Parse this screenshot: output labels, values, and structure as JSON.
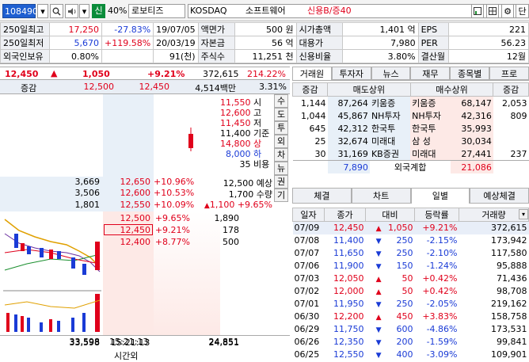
{
  "toolbar": {
    "code": "108490",
    "credit_badge": "신",
    "margin_rate": "40%",
    "stock_name": "로보티즈",
    "market": "KOSDAQ",
    "sector": "소프트웨어",
    "credit_info": "신용B/증40",
    "last_button": "단"
  },
  "info": {
    "rows": [
      [
        "250일최고",
        "17,250",
        "-27.83%",
        "19/07/05",
        "액면가",
        "500 원",
        "시가총액",
        "1,401 억",
        "EPS",
        "221"
      ],
      [
        "250일최저",
        "5,670",
        "+119.58%",
        "20/03/19",
        "자본금",
        "56 억",
        "대용가",
        "7,980",
        "PER",
        "56.23"
      ],
      [
        "외국인보유",
        "0.80%",
        "",
        "91(천)",
        "주식수",
        "11,251 천",
        "신용비율",
        "3.80%",
        "결산월",
        "12월"
      ]
    ]
  },
  "price_bar": {
    "price": "12,450",
    "change": "1,050",
    "rate": "+9.21%",
    "volume": "372,615",
    "vol_rate": "214.22%"
  },
  "header2": {
    "label": "증감",
    "ask": "12,500",
    "bid": "12,450",
    "amount": "4,514백만",
    "pct": "3.31%"
  },
  "side_info": [
    {
      "val": "11,550",
      "lbl": "시"
    },
    {
      "val": "12,600",
      "lbl": "고"
    },
    {
      "val": "11,450",
      "lbl": "저"
    },
    {
      "val": "11,400",
      "lbl": "기준"
    },
    {
      "val": "14,800",
      "lbl": "상"
    },
    {
      "val": "8,000",
      "lbl": "하"
    },
    {
      "val": "35",
      "lbl": "비용"
    }
  ],
  "side_tabs": [
    "수",
    "도",
    "투",
    "외",
    "차",
    "뉴",
    "권",
    "기"
  ],
  "asks": [
    {
      "qty": "3,669",
      "price": "12,650",
      "rate": "+10.96%"
    },
    {
      "qty": "3,506",
      "price": "12,600",
      "rate": "+10.53%"
    },
    {
      "qty": "1,801",
      "price": "12,550",
      "rate": "+10.09%"
    }
  ],
  "expected": {
    "price": "12,500",
    "label1": "예상",
    "qty": "1,700",
    "label2": "수량",
    "chg": "1,100",
    "rate": "+9.65%"
  },
  "bids": [
    {
      "price": "12,500",
      "rate": "+9.65%",
      "qty": "1,890"
    },
    {
      "price": "12,450",
      "rate": "+9.21%",
      "qty": "178"
    },
    {
      "price": "12,400",
      "rate": "+8.77%",
      "qty": "500"
    }
  ],
  "footer": {
    "ask_total": "33,598",
    "time": "15:21:13",
    "bid_total": "24,851",
    "after_hours": "시간외"
  },
  "right_tabs": [
    "거래원",
    "투자자",
    "뉴스",
    "재무",
    "종목별",
    "프로"
  ],
  "broker": {
    "headers": [
      "증감",
      "매도상위",
      "매수상위",
      "증감"
    ],
    "rows": [
      {
        "sc": "1,144",
        "sq": "87,264",
        "sn": "키움증",
        "bn": "키움증",
        "bq": "68,147",
        "bc": "2,053"
      },
      {
        "sc": "1,044",
        "sq": "45,867",
        "sn": "NH투자",
        "bn": "NH투자",
        "bq": "42,316",
        "bc": "809"
      },
      {
        "sc": "645",
        "sq": "42,312",
        "sn": "한국투",
        "bn": "한국투",
        "bq": "35,993",
        "bc": ""
      },
      {
        "sc": "25",
        "sq": "32,674",
        "sn": "미래대",
        "bn": "삼 성",
        "bq": "30,034",
        "bc": ""
      },
      {
        "sc": "30",
        "sq": "31,169",
        "sn": "KB증권",
        "bn": "미래대",
        "bq": "27,441",
        "bc": "237"
      }
    ],
    "foreign": {
      "sell": "7,890",
      "label": "외국계합",
      "buy": "21,086"
    }
  },
  "lower_tabs": [
    "체결",
    "차트",
    "일별",
    "예상체결"
  ],
  "history": {
    "headers": [
      "일자",
      "종가",
      "대비",
      "등락률",
      "거래량"
    ],
    "rows": [
      {
        "d": "07/09",
        "c": "12,450",
        "dir": "up",
        "v": "1,050",
        "r": "+9.21%",
        "q": "372,615"
      },
      {
        "d": "07/08",
        "c": "11,400",
        "dir": "down",
        "v": "250",
        "r": "-2.15%",
        "q": "173,942"
      },
      {
        "d": "07/07",
        "c": "11,650",
        "dir": "down",
        "v": "250",
        "r": "-2.10%",
        "q": "117,580"
      },
      {
        "d": "07/06",
        "c": "11,900",
        "dir": "down",
        "v": "150",
        "r": "-1.24%",
        "q": "95,888"
      },
      {
        "d": "07/03",
        "c": "12,050",
        "dir": "up",
        "v": "50",
        "r": "+0.42%",
        "q": "71,436"
      },
      {
        "d": "07/02",
        "c": "12,000",
        "dir": "up",
        "v": "50",
        "r": "+0.42%",
        "q": "98,708"
      },
      {
        "d": "07/01",
        "c": "11,950",
        "dir": "down",
        "v": "250",
        "r": "-2.05%",
        "q": "219,162"
      },
      {
        "d": "06/30",
        "c": "12,200",
        "dir": "up",
        "v": "450",
        "r": "+3.83%",
        "q": "158,758"
      },
      {
        "d": "06/29",
        "c": "11,750",
        "dir": "down",
        "v": "600",
        "r": "-4.86%",
        "q": "173,531"
      },
      {
        "d": "06/26",
        "c": "12,350",
        "dir": "down",
        "v": "200",
        "r": "-1.59%",
        "q": "99,841"
      },
      {
        "d": "06/25",
        "c": "12,550",
        "dir": "down",
        "v": "400",
        "r": "-3.09%",
        "q": "109,901"
      }
    ]
  }
}
